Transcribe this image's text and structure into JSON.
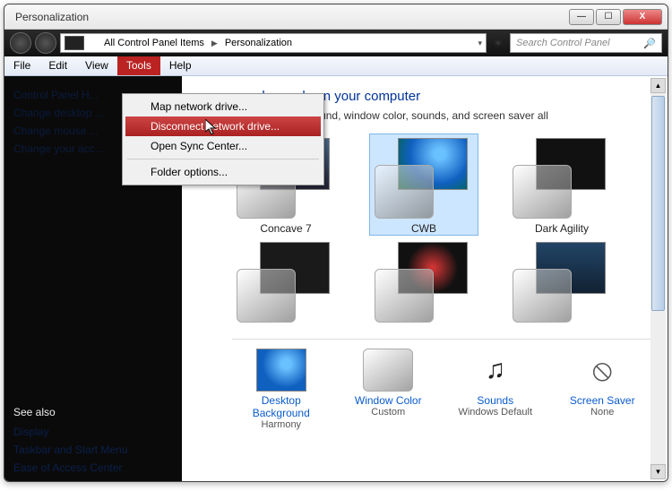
{
  "window": {
    "title": "Personalization"
  },
  "address": {
    "crumb1": "All Control Panel Items",
    "crumb2": "Personalization",
    "search_placeholder": "Search Control Panel"
  },
  "menubar": [
    "File",
    "Edit",
    "View",
    "Tools",
    "Help"
  ],
  "tools_menu": {
    "item1": "Map network drive...",
    "item2": "Disconnect network drive...",
    "item3": "Open Sync Center...",
    "item4": "Folder options..."
  },
  "sidebar": {
    "top": [
      "Control Panel H...",
      "Change desktop ...",
      "Change mouse ...",
      "Change your acc..."
    ],
    "see_also_hdr": "See also",
    "see_also": [
      "Display",
      "Taskbar and Start Menu",
      "Ease of Access Center"
    ]
  },
  "main": {
    "heading_suffix": "s and sounds on your computer",
    "desc_prefix": "e desktop background, window color, sounds, and screen saver all",
    "themes": [
      "Concave 7",
      "CWB",
      "Dark Agility"
    ]
  },
  "bottom": {
    "desktop": {
      "label": "Desktop Background",
      "sub": "Harmony"
    },
    "wincolor": {
      "label": "Window Color",
      "sub": "Custom"
    },
    "sounds": {
      "label": "Sounds",
      "sub": "Windows Default"
    },
    "scrsaver": {
      "label": "Screen Saver",
      "sub": "None"
    }
  }
}
